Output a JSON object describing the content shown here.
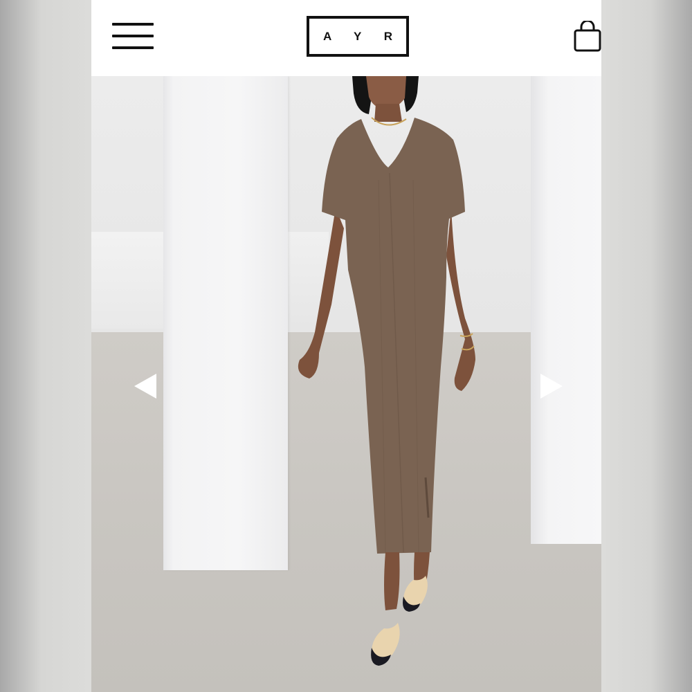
{
  "header": {
    "logo_text": "A Y R",
    "menu_icon": "hamburger-menu-icon",
    "bag_icon": "shopping-bag-icon"
  },
  "carousel": {
    "prev_icon": "arrow-left-icon",
    "next_icon": "arrow-right-icon"
  },
  "colors": {
    "dress": "#7a6352",
    "ink": "#111111",
    "arrow": "#ffffff"
  }
}
